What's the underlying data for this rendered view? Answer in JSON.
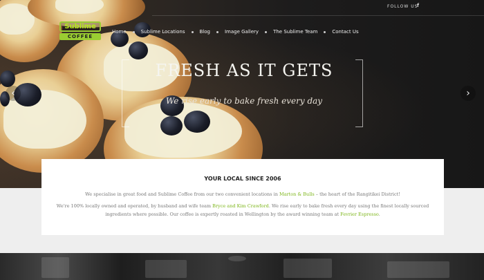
{
  "header": {
    "follow_label": "FOLLOW US",
    "facebook_icon": "f",
    "logo_line1": "Sublime",
    "logo_line2": "COFFEE",
    "accent_color": "#8cc63f"
  },
  "nav": {
    "items": [
      {
        "label": "Home"
      },
      {
        "label": "Sublime Locations"
      },
      {
        "label": "Blog"
      },
      {
        "label": "Image Gallery"
      },
      {
        "label": "The Sublime Team"
      },
      {
        "label": "Contact Us"
      }
    ]
  },
  "hero": {
    "headline": "FRESH AS IT GETS",
    "tagline": "We rise early to bake fresh every day",
    "prev_arrow": "‹",
    "next_arrow": "›"
  },
  "intro": {
    "title": "YOUR LOCAL SINCE 2006",
    "p1_before": "We specialise in great food and Sublime Coffee from our two convenient locations in ",
    "p1_link": "Marton & Bulls",
    "p1_after": " – the heart of the Rangitikei District!",
    "p2_before": "We're 100% locally owned and operated, by husband and wife team ",
    "p2_link1": "Bryce and Kim Crawford",
    "p2_middle": ". We rise early to bake fresh every day using the finest locally sourced ingredients where possible. Our coffee is expertly roasted in Wellington by the award winning team at ",
    "p2_link2": "Fevrier Espresso",
    "p2_after": "."
  }
}
